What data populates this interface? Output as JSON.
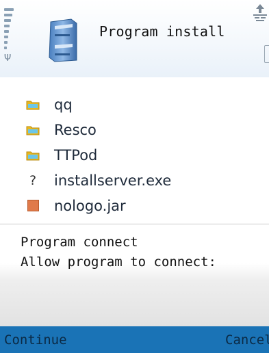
{
  "header": {
    "title": "Program install",
    "app_icon": "installer-icon",
    "signal_icon": "signal-strength-icon",
    "network_icon": "network-transfer-icon",
    "battery_icon": "battery-icon"
  },
  "files": [
    {
      "name": "qq",
      "icon": "folder-icon"
    },
    {
      "name": "Resco",
      "icon": "folder-icon"
    },
    {
      "name": "TTPod",
      "icon": "folder-icon"
    },
    {
      "name": "installserver.exe",
      "icon": "unknown-file-icon",
      "icon_glyph": "?"
    },
    {
      "name": "nologo.jar",
      "icon": "jar-file-icon"
    }
  ],
  "dialog": {
    "line1": "Program connect",
    "line2": "Allow program to connect:"
  },
  "softkeys": {
    "left": "Continue",
    "right": "Cancel"
  },
  "colors": {
    "softkey_bar": "#1a73b6",
    "folder": "#e9b820",
    "jar_file": "#e07a4a"
  }
}
